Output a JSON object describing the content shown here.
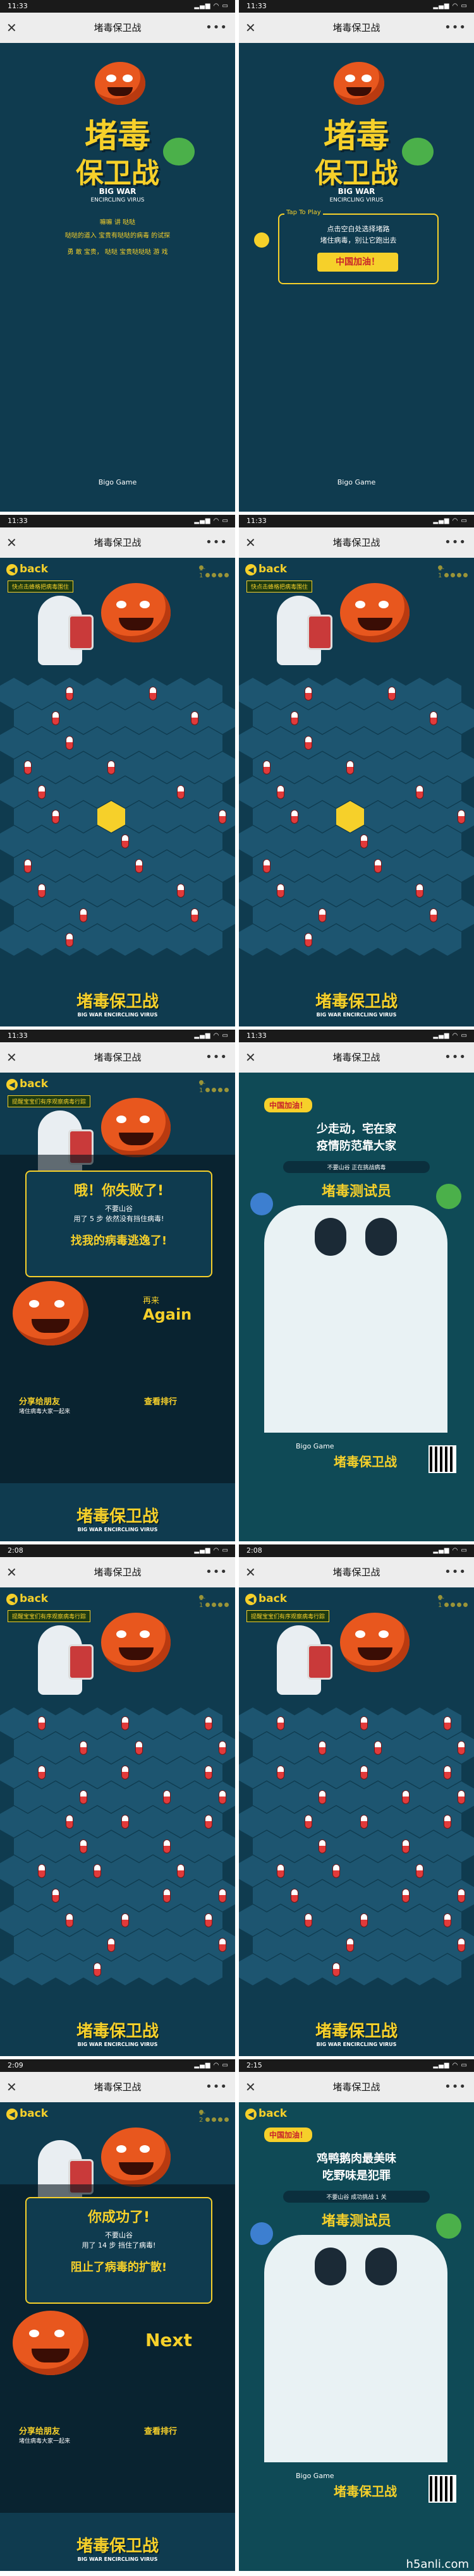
{
  "app": {
    "title": "堵毒保卫战",
    "close_glyph": "✕",
    "more_glyph": "•••",
    "signal_glyph": "▂▄▆ ◠ ▭"
  },
  "screens": [
    {
      "time": "11:33"
    },
    {
      "time": "11:33"
    },
    {
      "time": "11:33"
    },
    {
      "time": "11:33"
    },
    {
      "time": "11:33"
    },
    {
      "time": "11:33"
    },
    {
      "time": "2:08"
    },
    {
      "time": "2:08"
    },
    {
      "time": "2:09"
    },
    {
      "time": "2:15"
    }
  ],
  "home": {
    "logo_line1": "堵毒",
    "logo_line2": "保卫战",
    "logo_en1": "BIG WAR",
    "logo_en2": "ENCIRCLING VIRUS",
    "intro1": "嘛嘛 讲 哒哒",
    "intro2": "哒哒的道入 宝贵有哒哒的病毒 的试探",
    "intro3": "勇 敢 宝贵， 哒哒 宝贵哒哒哒 游 戏",
    "brand": "Bigo Game",
    "tap_label": "Tap To Play",
    "tap_text1": "点击空白处选择堵路",
    "tap_text2": "堵住病毒，别让它跑出去",
    "cta": "中国加油！"
  },
  "game": {
    "back": "back",
    "level_a": "1-1",
    "level_b": "1-2",
    "hint_a": "快点击蜂格把病毒围住",
    "hint_b": "提醒宝宝们有序观察病毒行踪",
    "foot_logo": "堵毒保卫战",
    "foot_en": "BIG WAR ENCIRCLING VIRUS"
  },
  "fail": {
    "title": "哦！你失败了!",
    "sub1": "不要山谷",
    "sub2": "用了 5 步 依然没有挡住病毒!",
    "line": "找我的病毒逃逸了!",
    "again_cn": "再来",
    "again_en": "Again",
    "share1": "分享给朋友",
    "share2": "堵住病毒大家一起来",
    "more": "查看排行"
  },
  "win": {
    "title": "你成功了!",
    "sub1": "不要山谷",
    "sub2": "用了 14 步 挡住了病毒!",
    "line": "阻止了病毒的扩散!",
    "next": "Next",
    "share1": "分享给朋友",
    "share2": "堵住病毒大家一起来",
    "more": "查看排行"
  },
  "poster_a": {
    "head": "中国加油！",
    "slogan1": "少走动，宅在家",
    "slogan2": "疫情防范靠大家",
    "user": "不要山谷 正在挑战病毒",
    "badge": "堵毒测试员",
    "brand": "Bigo Game",
    "logo": "堵毒保卫战"
  },
  "poster_b": {
    "head": "中国加油！",
    "slogan1": "鸡鸭鹅肉最美味",
    "slogan2": "吃野味是犯罪",
    "user": "不要山谷 成功挑战 1 关",
    "badge": "堵毒测试员",
    "brand": "Bigo Game",
    "logo": "堵毒保卫战"
  },
  "watermark": "h5anli.com"
}
